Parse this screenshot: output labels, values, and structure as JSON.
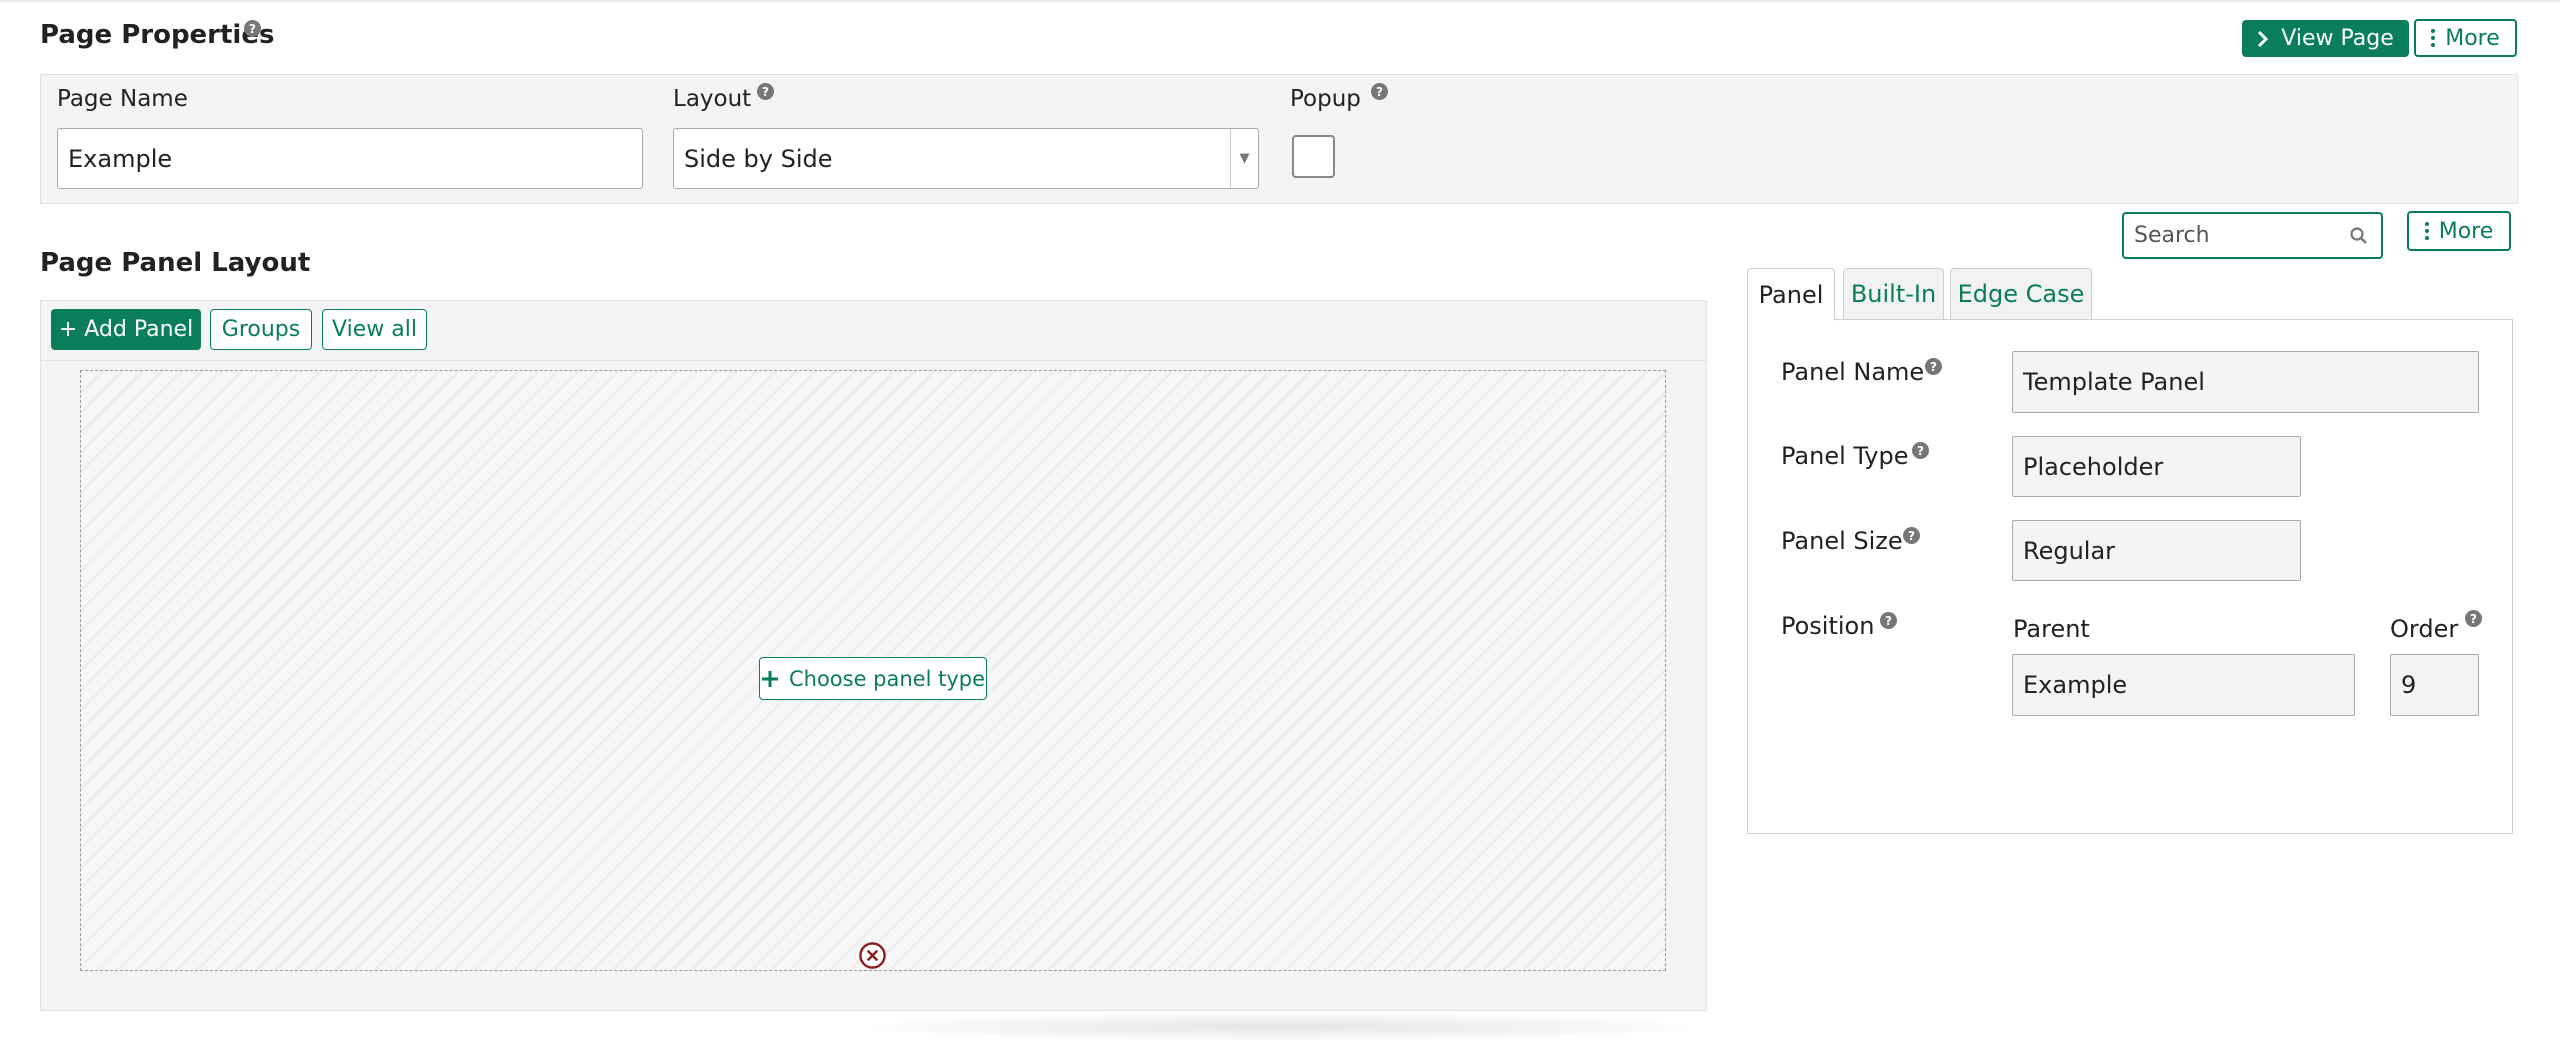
{
  "page_properties": {
    "title": "Page Properties",
    "view_page_label": "View Page",
    "more_label": "More",
    "page_name_label": "Page Name",
    "page_name_value": "Example",
    "layout_label": "Layout",
    "layout_value": "Side by Side",
    "popup_label": "Popup",
    "popup_checked": false
  },
  "panel_layout": {
    "title": "Page Panel Layout",
    "add_panel_label": "+ Add Panel",
    "groups_label": "Groups",
    "view_all_label": "View all",
    "choose_panel_label": "Choose panel type"
  },
  "right_panel": {
    "search_placeholder": "Search",
    "more_label": "More",
    "tabs": [
      {
        "label": "Panel",
        "active": true
      },
      {
        "label": "Built-In",
        "active": false
      },
      {
        "label": "Edge Case",
        "active": false
      }
    ],
    "panel_name_label": "Panel Name",
    "panel_name_value": "Template Panel",
    "panel_type_label": "Panel Type",
    "panel_type_value": "Placeholder",
    "panel_size_label": "Panel Size",
    "panel_size_value": "Regular",
    "position_label": "Position",
    "parent_label": "Parent",
    "parent_value": "Example",
    "order_label": "Order",
    "order_value": "9"
  },
  "colors": {
    "accent": "#0a7d5b",
    "danger": "#8b1d1d",
    "panel_bg": "#f4f4f4"
  },
  "icons": [
    "help-icon",
    "chevron-right-icon",
    "kebab-icon",
    "search-icon",
    "plus-icon",
    "remove-circle-icon",
    "dropdown-arrow-icon"
  ]
}
